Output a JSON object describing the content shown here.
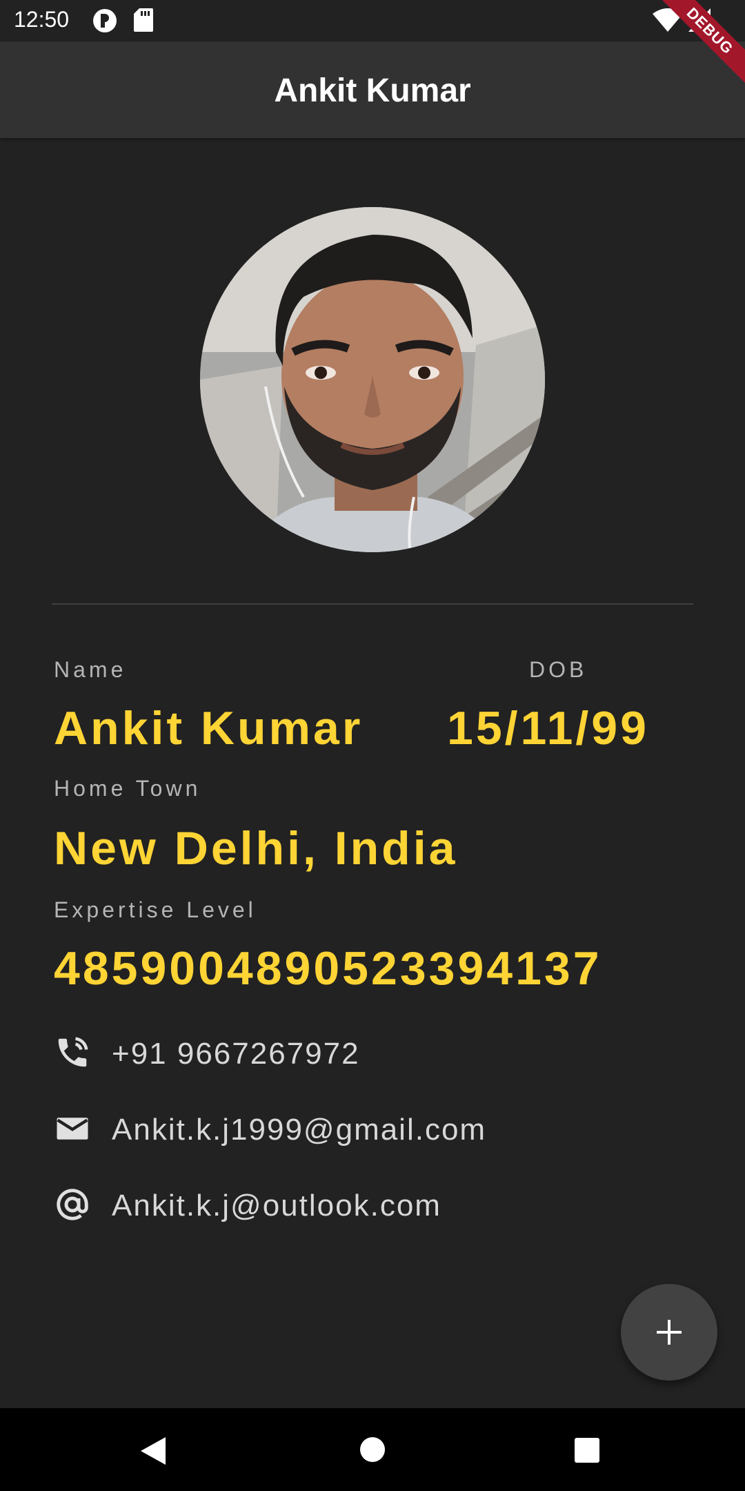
{
  "status_bar": {
    "time": "12:50",
    "icons": [
      "app-notification-icon",
      "sd-card-icon",
      "wifi-icon",
      "signal-icon"
    ]
  },
  "app_bar": {
    "title": "Ankit Kumar",
    "debug_label": "DEBUG",
    "debug_color": "#a3172b"
  },
  "profile": {
    "avatar": "profile-photo",
    "name_label": "Name",
    "name": "Ankit Kumar",
    "dob_label": "DOB",
    "dob": "15/11/99",
    "hometown_label": "Home Town",
    "hometown": "New Delhi, India",
    "expertise_label": "Expertise Level",
    "expertise": "4859004890523394137"
  },
  "contacts": [
    {
      "icon": "phone-icon",
      "text": "+91 9667267972"
    },
    {
      "icon": "mail-icon",
      "text": "Ankit.k.j1999@gmail.com"
    },
    {
      "icon": "at-sign-icon",
      "text": "Ankit.k.j@outlook.com"
    }
  ],
  "fab": {
    "icon": "plus-icon"
  },
  "nav_bar": {
    "icons": [
      "back-icon",
      "home-icon",
      "recents-icon"
    ]
  },
  "colors": {
    "background": "#222222",
    "app_bar": "#323232",
    "accent": "#ffd435",
    "label": "#b5b5b5",
    "contact_text": "#d8d8d8",
    "fab": "#424242"
  }
}
